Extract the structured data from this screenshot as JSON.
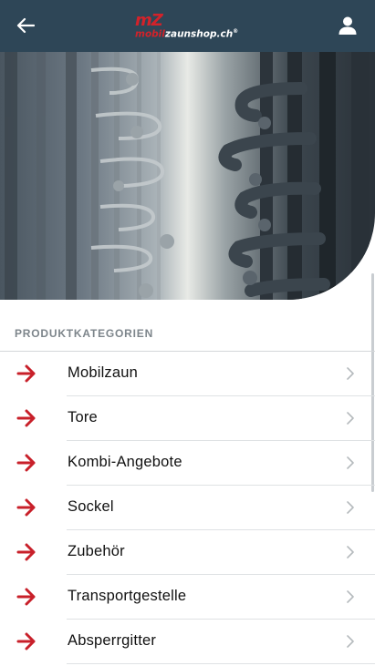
{
  "header": {
    "back_icon": "arrow-left-icon",
    "logo": {
      "mark": "mZ",
      "name_red": "mobil",
      "name_white": "zaunshop.ch",
      "trademark": "®"
    },
    "user_icon": "user-icon",
    "background_color": "#2e4657"
  },
  "hero": {
    "image": "close-up of stacked mobile fence panels with metal hooks"
  },
  "categories": {
    "title": "PRODUKTKATEGORIEN",
    "arrow_color": "#c8202a",
    "items": [
      {
        "label": "Mobilzaun"
      },
      {
        "label": "Tore"
      },
      {
        "label": "Kombi-Angebote"
      },
      {
        "label": "Sockel"
      },
      {
        "label": "Zubehör"
      },
      {
        "label": "Transportgestelle"
      },
      {
        "label": "Absperrgitter"
      }
    ]
  }
}
